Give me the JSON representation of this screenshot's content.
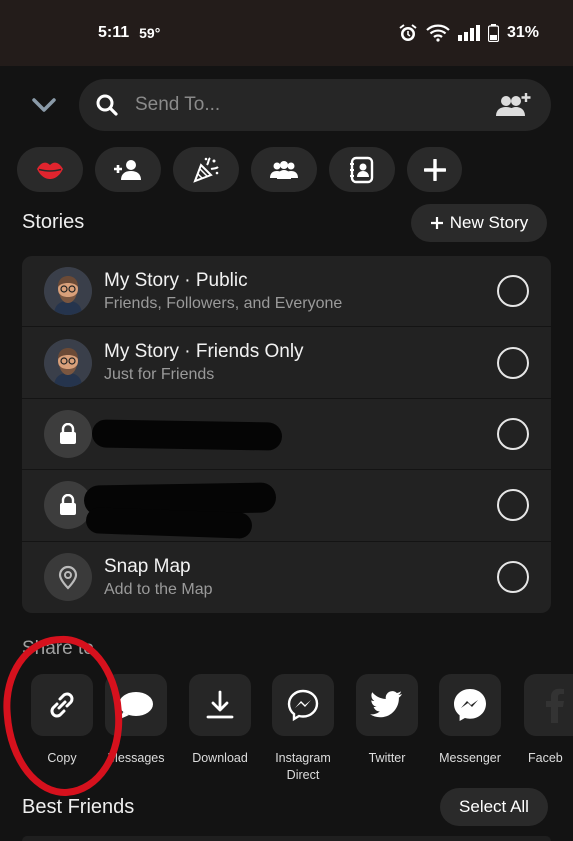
{
  "status_bar": {
    "time": "5:11",
    "temperature": "59°",
    "battery": "31%"
  },
  "search": {
    "placeholder": "Send To..."
  },
  "chips": [
    {
      "icon": "lips-icon",
      "color": "#e0242e"
    },
    {
      "icon": "add-friend-icon"
    },
    {
      "icon": "party-popper-icon"
    },
    {
      "icon": "group-icon"
    },
    {
      "icon": "contacts-icon"
    },
    {
      "icon": "plus-icon"
    }
  ],
  "stories": {
    "title": "Stories",
    "new_story_label": "New Story",
    "items": [
      {
        "name": "My Story · Public",
        "sub": "Friends, Followers, and Everyone"
      },
      {
        "name": "My Story · Friends Only",
        "sub": "Just for Friends"
      },
      {
        "name": "",
        "sub": ""
      },
      {
        "name": "",
        "sub": ""
      },
      {
        "name": "Snap Map",
        "sub": "Add to the Map"
      }
    ]
  },
  "share": {
    "title": "Share to",
    "items": [
      {
        "label": "Copy",
        "icon": "link-icon"
      },
      {
        "label": "Messages",
        "icon": "chat-bubble-icon"
      },
      {
        "label": "Download",
        "icon": "download-icon"
      },
      {
        "label": "Instagram Direct",
        "icon": "instagram-direct-icon"
      },
      {
        "label": "Twitter",
        "icon": "twitter-icon"
      },
      {
        "label": "Messenger",
        "icon": "messenger-icon"
      },
      {
        "label": "Faceb",
        "icon": "facebook-icon"
      }
    ]
  },
  "best_friends": {
    "title": "Best Friends",
    "select_all_label": "Select All"
  },
  "colors": {
    "background": "#131313",
    "surface": "#222222",
    "annotation_red": "#d6111d"
  }
}
